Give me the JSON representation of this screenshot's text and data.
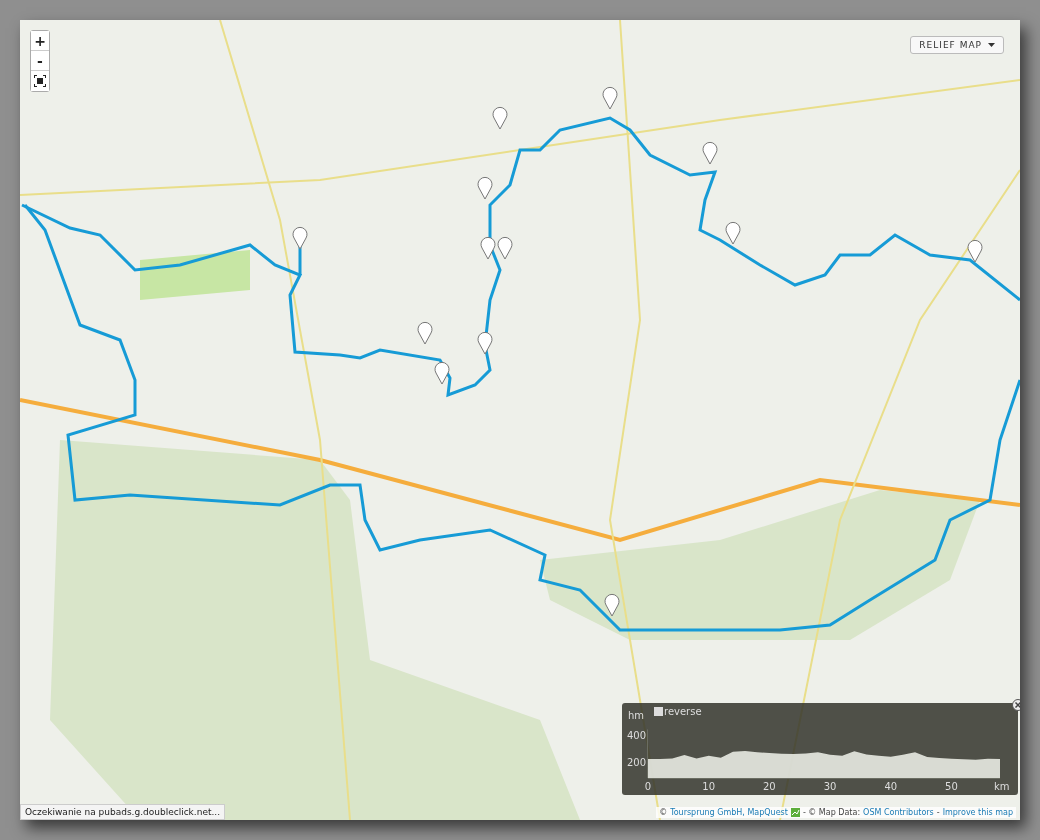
{
  "map_controls": {
    "zoom_in": "+",
    "zoom_out": "-"
  },
  "layer_button": {
    "label": "RELIEF MAP"
  },
  "elevation_profile": {
    "reverse": {
      "label": "reverse",
      "checked": false
    },
    "chart_data": {
      "type": "area",
      "xlabel": "km",
      "ylabel": "hm",
      "x": [
        0,
        2,
        4,
        6,
        8,
        10,
        12,
        14,
        16,
        18,
        20,
        22,
        24,
        26,
        28,
        30,
        32,
        34,
        36,
        38,
        40,
        42,
        44,
        46,
        48,
        50,
        52,
        54,
        56,
        58
      ],
      "series": [
        {
          "color": "#e8eae2",
          "values": [
            230,
            230,
            235,
            260,
            235,
            255,
            240,
            285,
            290,
            280,
            275,
            270,
            268,
            272,
            280,
            262,
            255,
            288,
            265,
            255,
            248,
            262,
            280,
            245,
            238,
            232,
            228,
            225,
            232,
            230
          ]
        }
      ],
      "xlim": [
        0,
        58
      ],
      "ylim": [
        90,
        450
      ],
      "xticks": [
        0,
        10,
        20,
        30,
        40,
        50
      ],
      "yticks": [
        200,
        400
      ]
    }
  },
  "status_bar": {
    "text": "Oczekiwanie na pubads.g.doubleclick.net..."
  },
  "attribution": [
    {
      "kind": "text",
      "text": "©"
    },
    {
      "kind": "link",
      "text": "Toursprung GmbH, MapQuest"
    },
    {
      "kind": "icon"
    },
    {
      "kind": "text",
      "text": "- © Map Data:"
    },
    {
      "kind": "link",
      "text": "OSM Contributors"
    },
    {
      "kind": "text",
      "text": "-"
    },
    {
      "kind": "link",
      "text": "Improve this map"
    }
  ]
}
